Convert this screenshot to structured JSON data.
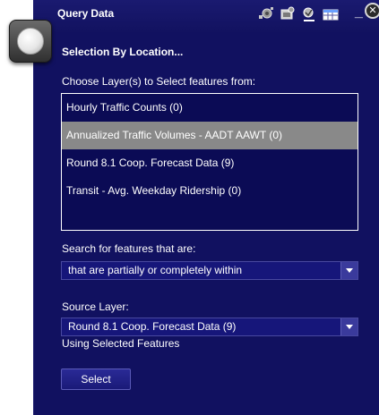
{
  "window": {
    "title": "Query Data",
    "toolbar_icons": [
      "selection-tool-icon",
      "query-layers-icon",
      "query-results-icon",
      "table-view-icon"
    ],
    "minimize_label": "_",
    "close_label": "✕"
  },
  "form": {
    "heading": "Selection By Location...",
    "choose_layers_label": "Choose Layer(s) to Select features from:",
    "layers": [
      {
        "label": "Hourly Traffic Counts (0)",
        "selected": false
      },
      {
        "label": "Annualized Traffic Volumes - AADT AAWT (0)",
        "selected": true
      },
      {
        "label": "Round 8.1 Coop. Forecast Data (9)",
        "selected": false
      },
      {
        "label": "Transit - Avg. Weekday Ridership (0)",
        "selected": false
      }
    ],
    "search_label": "Search for features that are:",
    "spatial_relation_value": "that are partially or completely within",
    "source_layer_label": "Source Layer:",
    "source_layer_value": "Round 8.1 Coop. Forecast Data (9)",
    "using_selected_label": "Using Selected Features",
    "select_button_label": "Select"
  },
  "colors": {
    "panel_background": "#111160",
    "selected_row": "#898989",
    "text": "#ffffff"
  }
}
